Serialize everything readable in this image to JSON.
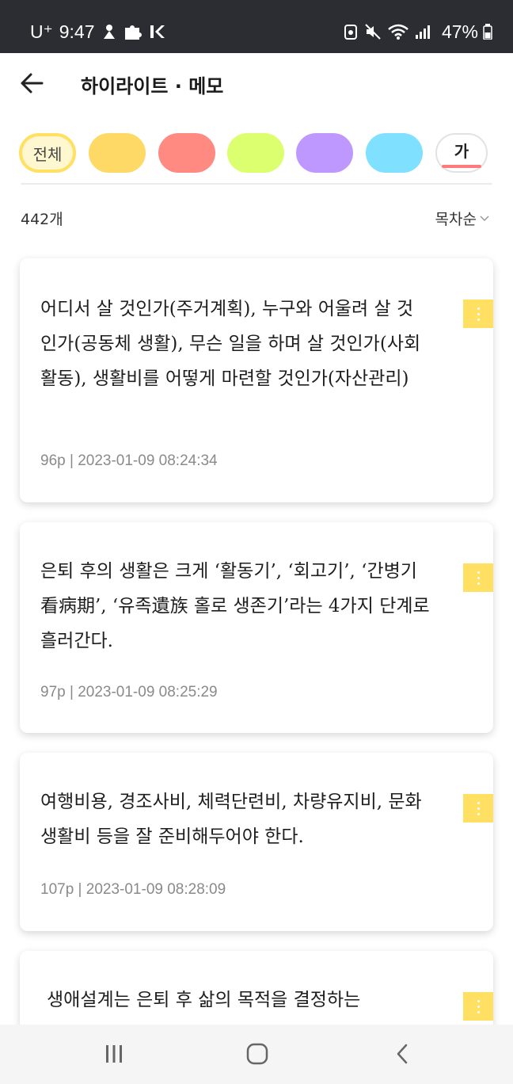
{
  "status_bar": {
    "carrier": "U⁺",
    "time": "9:47",
    "battery": "47%"
  },
  "header": {
    "title": "하이라이트 · 메모"
  },
  "filters": {
    "all_label": "전체",
    "text_label": "가",
    "colors": {
      "yellow": "#ffd966",
      "red": "#ff8a82",
      "green": "#dcff70",
      "purple": "#bf98ff",
      "blue": "#7fe0ff"
    }
  },
  "list": {
    "count": "442개",
    "sort_label": "목차순"
  },
  "cards": [
    {
      "text": "어디서 살 것인가(주거계획), 누구와 어울려 살 것인가(공동체 생활), 무슨 일을 하며 살 것인가(사회활동), 생활비를 어떻게 마련할 것인가(자산관리)",
      "meta": "96p | 2023-01-09 08:24:34"
    },
    {
      "text": "은퇴 후의 생활은 크게 ‘활동기’, ‘회고기’, ‘간병기看病期’, ‘유족遺族 홀로 생존기’라는 4가지 단계로 흘러간다.",
      "meta": "97p | 2023-01-09 08:25:29"
    },
    {
      "text": "여행비용, 경조사비, 체력단련비, 차량유지비, 문화생활비 등을 잘 준비해두어야 한다.",
      "meta": "107p | 2023-01-09 08:28:09"
    },
    {
      "text": "생애설계는 은퇴 후 삶의 목적을 결정하는",
      "meta": ""
    }
  ],
  "icons": {
    "back": "arrow-left-icon",
    "more": "more-vertical-icon",
    "sort": "chevron-down-icon",
    "nav_recent": "recent-apps-icon",
    "nav_home": "home-icon",
    "nav_back": "chevron-left-icon"
  }
}
